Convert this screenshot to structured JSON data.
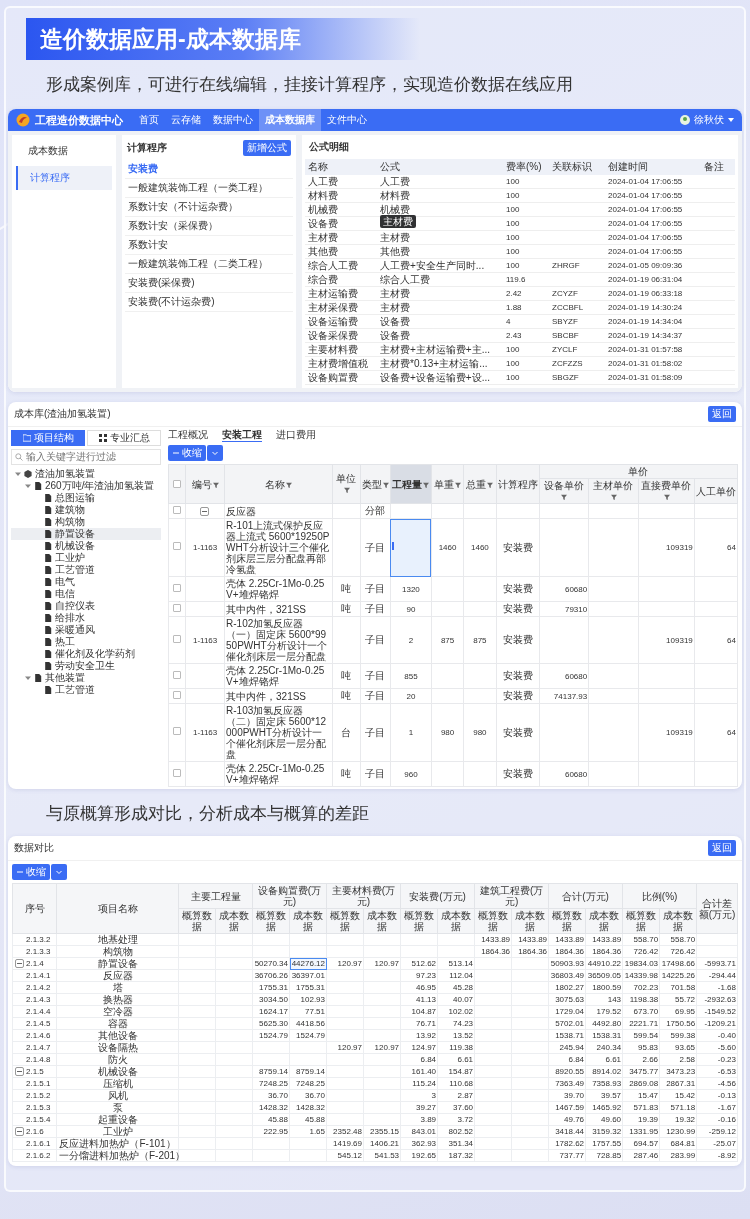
{
  "banner": {
    "title": "造价数据应用-成本数据库"
  },
  "intro": "形成案例库，可进行在线编辑，挂接计算程序，实现造价数据在线应用",
  "portal": {
    "app_name": "工程造价数据中心",
    "nav": [
      {
        "label": "首页",
        "selected": false
      },
      {
        "label": "云存储",
        "selected": false
      },
      {
        "label": "数据中心",
        "selected": false
      },
      {
        "label": "成本数据库",
        "selected": true
      },
      {
        "label": "文件中心",
        "selected": false
      }
    ],
    "user": "徐秋伏",
    "sidebar": [
      {
        "label": "成本数据",
        "selected": false
      },
      {
        "label": "计算程序",
        "selected": true
      }
    ],
    "programs": {
      "title": "计算程序",
      "add_button": "新增公式",
      "items": [
        {
          "label": "安装费",
          "selected": true
        },
        {
          "label": "一般建筑装饰工程（一类工程）",
          "selected": false
        },
        {
          "label": "系数计安（不计运杂费）",
          "selected": false
        },
        {
          "label": "系数计安（采保费）",
          "selected": false
        },
        {
          "label": "系数计安",
          "selected": false
        },
        {
          "label": "一般建筑装饰工程（二类工程）",
          "selected": false
        },
        {
          "label": "安装费(采保费)",
          "selected": false
        },
        {
          "label": "安装费(不计运杂费)",
          "selected": false
        }
      ]
    },
    "formulas": {
      "title": "公式明细",
      "columns": [
        "名称",
        "公式",
        "费率(%)",
        "关联标识",
        "创建时间",
        "备注"
      ],
      "rows": [
        {
          "name": "人工费",
          "formula": "人工费",
          "rate": "100",
          "created": "2024-01-04 17:06:55"
        },
        {
          "name": "材料费",
          "formula": "材料费",
          "rate": "100",
          "created": "2024-01-04 17:06:55"
        },
        {
          "name": "机械费",
          "formula": "机械费",
          "rate": "100",
          "created": "2024-01-04 17:06:55"
        },
        {
          "name": "设备费",
          "tooltip": "主材费",
          "rate": "100",
          "created": "2024-01-04 17:06:55"
        },
        {
          "name": "主材费",
          "formula": "主材费",
          "rate": "100",
          "created": "2024-01-04 17:06:55"
        },
        {
          "name": "其他费",
          "formula": "其他费",
          "rate": "100",
          "created": "2024-01-04 17:06:55"
        },
        {
          "name": "综合人工费",
          "formula": "人工费+安全生产同时...",
          "rate": "100",
          "tag": "ZHRGF",
          "created": "2024-01-05 09:09:36"
        },
        {
          "name": "综合费",
          "formula": "综合人工费",
          "rate": "119.6",
          "created": "2024-01-19 06:31:04"
        },
        {
          "name": "主材运输费",
          "formula": "主材费",
          "rate": "2.42",
          "tag": "ZCYZF",
          "created": "2024-01-19 06:33:18"
        },
        {
          "name": "主材采保费",
          "formula": "主材费",
          "rate": "1.88",
          "tag": "ZCCBFL",
          "created": "2024-01-19 14:30:24"
        },
        {
          "name": "设备运输费",
          "formula": "设备费",
          "rate": "4",
          "tag": "SBYZF",
          "created": "2024-01-19 14:34:04"
        },
        {
          "name": "设备采保费",
          "formula": "设备费",
          "rate": "2.43",
          "tag": "SBCBF",
          "created": "2024-01-19 14:34:37"
        },
        {
          "name": "主要材料费",
          "formula": "主材费+主材运输费+主...",
          "rate": "100",
          "tag": "ZYCLF",
          "created": "2024-01-31 01:57:58"
        },
        {
          "name": "主材费增值税",
          "formula": "主材费*0.13+主材运输...",
          "rate": "100",
          "tag": "ZCFZZS",
          "created": "2024-01-31 01:58:02"
        },
        {
          "name": "设备购置费",
          "formula": "设备费+设备运输费+设...",
          "rate": "100",
          "tag": "SBGZF",
          "created": "2024-01-31 01:58:09"
        }
      ]
    }
  },
  "library": {
    "title": "成本库(渣油加氢装置)",
    "back_button": "返回",
    "side_tabs": [
      {
        "label": "项目结构",
        "selected": true
      },
      {
        "label": "专业汇总",
        "selected": false
      }
    ],
    "search": {
      "placeholder": "输入关键字进行过滤"
    },
    "tree": [
      {
        "label": "渣油加氢装置",
        "expanded": true,
        "selected": false,
        "children": [
          {
            "label": "260万吨/年渣油加氢装置",
            "expanded": true,
            "selected": false,
            "children": [
              {
                "label": "总图运输",
                "selected": false
              },
              {
                "label": "建筑物",
                "selected": false
              },
              {
                "label": "构筑物",
                "selected": false
              },
              {
                "label": "静置设备",
                "selected": true
              },
              {
                "label": "机械设备",
                "selected": false
              },
              {
                "label": "工业炉",
                "selected": false
              },
              {
                "label": "工艺管道",
                "selected": false
              },
              {
                "label": "电气",
                "selected": false
              },
              {
                "label": "电信",
                "selected": false
              },
              {
                "label": "自控仪表",
                "selected": false
              },
              {
                "label": "给排水",
                "selected": false
              },
              {
                "label": "采暖通风",
                "selected": false
              },
              {
                "label": "热工",
                "selected": false
              },
              {
                "label": "催化剂及化学药剂",
                "selected": false
              },
              {
                "label": "劳动安全卫生",
                "selected": false
              }
            ]
          },
          {
            "label": "其他装置",
            "expanded": true,
            "selected": false,
            "children": [
              {
                "label": "工艺管道",
                "selected": false
              }
            ]
          }
        ]
      }
    ],
    "tabs": [
      {
        "label": "工程概况",
        "selected": false
      },
      {
        "label": "安装工程",
        "selected": true
      },
      {
        "label": "进口费用",
        "selected": false
      }
    ],
    "collapse_button": "收缩",
    "all_checked": false,
    "columns": [
      {
        "label": "编号",
        "filter": true,
        "selected": false
      },
      {
        "label": "名称",
        "filter": true,
        "selected": false
      },
      {
        "label": "单位",
        "filter": true,
        "selected": false
      },
      {
        "label": "类型",
        "filter": true,
        "selected": false
      },
      {
        "label": "工程量",
        "filter": true,
        "selected": true
      },
      {
        "label": "单重",
        "filter": true,
        "selected": false
      },
      {
        "label": "总重",
        "filter": true,
        "selected": false
      },
      {
        "label": "计算程序",
        "filter": false,
        "selected": false
      }
    ],
    "price_group": {
      "label": "单价",
      "columns": [
        {
          "label": "设备单价",
          "filter": true
        },
        {
          "label": "主材单价",
          "filter": true
        },
        {
          "label": "直接费单价",
          "filter": true
        },
        {
          "label": "人工单价",
          "filter": false
        }
      ]
    },
    "rows": [
      {
        "kind": "group",
        "expanded": true,
        "checked": false,
        "editing": false,
        "name": "反应器",
        "type": "分部"
      },
      {
        "kind": "item",
        "checked": false,
        "editing": true,
        "code": "1-1163",
        "name": "R-101上流式保护反应器上流式 5600*19250PWHT分析设计三个催化剂床层三层分配盘再部冷氢盘",
        "type": "子目",
        "unit_weight": "1460",
        "total_weight": "1460",
        "program": "安装费",
        "direct_price": "109319",
        "labor_price": "64"
      },
      {
        "kind": "item",
        "checked": false,
        "editing": false,
        "name": "壳体 2.25Cr-1Mo-0.25V+堆焊铬焊",
        "unit": "吨",
        "type": "子目",
        "qty": "1320",
        "program": "安装费",
        "equip_price": "60680"
      },
      {
        "kind": "item",
        "checked": false,
        "editing": false,
        "name": "其中内件，321SS",
        "unit": "吨",
        "type": "子目",
        "qty": "90",
        "program": "安装费",
        "equip_price": "79310"
      },
      {
        "kind": "item",
        "checked": false,
        "editing": false,
        "code": "1-1163",
        "name": "R-102加氢反应器（一）固定床 5600*9950PWHT分析设计一个催化剂床层一层分配盘",
        "type": "子目",
        "qty": "2",
        "unit_weight": "875",
        "total_weight": "875",
        "program": "安装费",
        "direct_price": "109319",
        "labor_price": "64"
      },
      {
        "kind": "item",
        "checked": false,
        "editing": false,
        "name": "壳体 2.25Cr-1Mo-0.25V+堆焊铬焊",
        "unit": "吨",
        "type": "子目",
        "qty": "855",
        "program": "安装费",
        "equip_price": "60680"
      },
      {
        "kind": "item",
        "checked": false,
        "editing": false,
        "name": "其中内件，321SS",
        "unit": "吨",
        "type": "子目",
        "qty": "20",
        "program": "安装费",
        "equip_price": "74137.93"
      },
      {
        "kind": "item",
        "checked": false,
        "editing": false,
        "code": "1-1163",
        "name": "R-103加氢反应器（二）固定床 5600*12000PWHT分析设计一个催化剂床层一层分配盘",
        "unit": "台",
        "type": "子目",
        "qty": "1",
        "unit_weight": "980",
        "total_weight": "980",
        "program": "安装费",
        "direct_price": "109319",
        "labor_price": "64"
      },
      {
        "kind": "item",
        "checked": false,
        "editing": false,
        "name": "壳体 2.25Cr-1Mo-0.25V+堆焊铬焊",
        "unit": "吨",
        "type": "子目",
        "qty": "960",
        "program": "安装费",
        "equip_price": "60680"
      }
    ]
  },
  "compare_intro": "与原概算形成对比，分析成本与概算的差距",
  "comparison": {
    "title": "数据对比",
    "back_button": "返回",
    "collapse_button": "收缩",
    "columns": [
      {
        "label": "序号"
      },
      {
        "label": "项目名称"
      },
      {
        "label": "主要工程量",
        "sub": [
          "概算数据",
          "成本数据"
        ]
      },
      {
        "label": "设备购置费(万元)",
        "sub": [
          "概算数据",
          "成本数据"
        ]
      },
      {
        "label": "主要材料费(万元)",
        "sub": [
          "概算数据",
          "成本数据"
        ]
      },
      {
        "label": "安装费(万元)",
        "sub": [
          "概算数据",
          "成本数据"
        ]
      },
      {
        "label": "建筑工程费(万元)",
        "sub": [
          "概算数据",
          "成本数据"
        ]
      },
      {
        "label": "合计(万元)",
        "sub": [
          "概算数据",
          "成本数据"
        ]
      },
      {
        "label": "比例(%)",
        "sub": [
          "概算数据",
          "成本数据"
        ]
      },
      {
        "label": "合计差额(万元)"
      }
    ],
    "rows": [
      {
        "kind": "item",
        "selected": false,
        "seq": "2.1.3.2",
        "name": "地基处理",
        "build_est": "1433.89",
        "build_cost": "1433.89",
        "total_est": "1433.89",
        "total_cost": "1433.89",
        "ratio_est": "558.70",
        "ratio_cost": "558.70"
      },
      {
        "kind": "item",
        "selected": false,
        "seq": "2.1.3.3",
        "name": "构筑物",
        "build_est": "1864.36",
        "build_cost": "1864.36",
        "total_est": "1864.36",
        "total_cost": "1864.36",
        "ratio_est": "726.42",
        "ratio_cost": "726.42"
      },
      {
        "kind": "group",
        "expanded": true,
        "selected": true,
        "seq": "2.1.4",
        "name": "静置设备",
        "equip_est": "50270.34",
        "equip_cost": "44276.12",
        "mat_est": "120.97",
        "mat_cost": "120.97",
        "inst_est": "512.62",
        "inst_cost": "513.14",
        "total_est": "50903.93",
        "total_cost": "44910.22",
        "ratio_est": "19834.03",
        "ratio_cost": "17498.66",
        "diff": "-5993.71"
      },
      {
        "kind": "item",
        "selected": false,
        "seq": "2.1.4.1",
        "name": "反应器",
        "equip_est": "36706.26",
        "equip_cost": "36397.01",
        "inst_est": "97.23",
        "inst_cost": "112.04",
        "total_est": "36803.49",
        "total_cost": "36509.05",
        "ratio_est": "14339.98",
        "ratio_cost": "14225.26",
        "diff": "-294.44"
      },
      {
        "kind": "item",
        "selected": false,
        "seq": "2.1.4.2",
        "name": "塔",
        "equip_est": "1755.31",
        "equip_cost": "1755.31",
        "inst_est": "46.95",
        "inst_cost": "45.28",
        "total_est": "1802.27",
        "total_cost": "1800.59",
        "ratio_est": "702.23",
        "ratio_cost": "701.58",
        "diff": "-1.68"
      },
      {
        "kind": "item",
        "selected": false,
        "seq": "2.1.4.3",
        "name": "换热器",
        "equip_est": "3034.50",
        "equip_cost": "102.93",
        "inst_est": "41.13",
        "inst_cost": "40.07",
        "total_est": "3075.63",
        "total_cost": "143",
        "ratio_est": "1198.38",
        "ratio_cost": "55.72",
        "diff": "-2932.63"
      },
      {
        "kind": "item",
        "selected": false,
        "seq": "2.1.4.4",
        "name": "空冷器",
        "equip_est": "1624.17",
        "equip_cost": "77.51",
        "inst_est": "104.87",
        "inst_cost": "102.02",
        "total_est": "1729.04",
        "total_cost": "179.52",
        "ratio_est": "673.70",
        "ratio_cost": "69.95",
        "diff": "-1549.52"
      },
      {
        "kind": "item",
        "selected": false,
        "seq": "2.1.4.5",
        "name": "容器",
        "equip_est": "5625.30",
        "equip_cost": "4418.56",
        "inst_est": "76.71",
        "inst_cost": "74.23",
        "total_est": "5702.01",
        "total_cost": "4492.80",
        "ratio_est": "2221.71",
        "ratio_cost": "1750.56",
        "diff": "-1209.21"
      },
      {
        "kind": "item",
        "selected": false,
        "seq": "2.1.4.6",
        "name": "其他设备",
        "equip_est": "1524.79",
        "equip_cost": "1524.79",
        "inst_est": "13.92",
        "inst_cost": "13.52",
        "total_est": "1538.71",
        "total_cost": "1538.31",
        "ratio_est": "599.54",
        "ratio_cost": "599.38",
        "diff": "-0.40"
      },
      {
        "kind": "item",
        "selected": false,
        "seq": "2.1.4.7",
        "name": "设备隔热",
        "mat_est": "120.97",
        "mat_cost": "120.97",
        "inst_est": "124.97",
        "inst_cost": "119.38",
        "total_est": "245.94",
        "total_cost": "240.34",
        "ratio_est": "95.83",
        "ratio_cost": "93.65",
        "diff": "-5.60"
      },
      {
        "kind": "item",
        "selected": false,
        "seq": "2.1.4.8",
        "name": "防火",
        "inst_est": "6.84",
        "inst_cost": "6.61",
        "total_est": "6.84",
        "total_cost": "6.61",
        "ratio_est": "2.66",
        "ratio_cost": "2.58",
        "diff": "-0.23"
      },
      {
        "kind": "group",
        "expanded": true,
        "selected": false,
        "seq": "2.1.5",
        "name": "机械设备",
        "equip_est": "8759.14",
        "equip_cost": "8759.14",
        "inst_est": "161.40",
        "inst_cost": "154.87",
        "total_est": "8920.55",
        "total_cost": "8914.02",
        "ratio_est": "3475.77",
        "ratio_cost": "3473.23",
        "diff": "-6.53"
      },
      {
        "kind": "item",
        "selected": false,
        "seq": "2.1.5.1",
        "name": "压缩机",
        "equip_est": "7248.25",
        "equip_cost": "7248.25",
        "inst_est": "115.24",
        "inst_cost": "110.68",
        "total_est": "7363.49",
        "total_cost": "7358.93",
        "ratio_est": "2869.08",
        "ratio_cost": "2867.31",
        "diff": "-4.56"
      },
      {
        "kind": "item",
        "selected": false,
        "seq": "2.1.5.2",
        "name": "风机",
        "equip_est": "36.70",
        "equip_cost": "36.70",
        "inst_est": "3",
        "inst_cost": "2.87",
        "total_est": "39.70",
        "total_cost": "39.57",
        "ratio_est": "15.47",
        "ratio_cost": "15.42",
        "diff": "-0.13"
      },
      {
        "kind": "item",
        "selected": false,
        "seq": "2.1.5.3",
        "name": "泵",
        "equip_est": "1428.32",
        "equip_cost": "1428.32",
        "inst_est": "39.27",
        "inst_cost": "37.60",
        "total_est": "1467.59",
        "total_cost": "1465.92",
        "ratio_est": "571.83",
        "ratio_cost": "571.18",
        "diff": "-1.67"
      },
      {
        "kind": "item",
        "selected": false,
        "seq": "2.1.5.4",
        "name": "起重设备",
        "equip_est": "45.88",
        "equip_cost": "45.88",
        "inst_est": "3.89",
        "inst_cost": "3.72",
        "total_est": "49.76",
        "total_cost": "49.60",
        "ratio_est": "19.39",
        "ratio_cost": "19.32",
        "diff": "-0.16"
      },
      {
        "kind": "group",
        "expanded": true,
        "selected": false,
        "seq": "2.1.6",
        "name": "工业炉",
        "equip_est": "222.95",
        "equip_cost": "1.65",
        "mat_est": "2352.48",
        "mat_cost": "2355.15",
        "inst_est": "843.01",
        "inst_cost": "802.52",
        "total_est": "3418.44",
        "total_cost": "3159.32",
        "ratio_est": "1331.95",
        "ratio_cost": "1230.99",
        "diff": "-259.12"
      },
      {
        "kind": "item",
        "selected": false,
        "seq": "2.1.6.1",
        "name": "反应进料加热炉（F-101）",
        "mat_est": "1419.69",
        "mat_cost": "1406.21",
        "inst_est": "362.93",
        "inst_cost": "351.34",
        "total_est": "1782.62",
        "total_cost": "1757.55",
        "ratio_est": "694.57",
        "ratio_cost": "684.81",
        "diff": "-25.07"
      },
      {
        "kind": "item",
        "selected": false,
        "seq": "2.1.6.2",
        "name": "一分馏进料加热炉（F-201）",
        "mat_est": "545.12",
        "mat_cost": "541.53",
        "inst_est": "192.65",
        "inst_cost": "187.32",
        "total_est": "737.77",
        "total_cost": "728.85",
        "ratio_est": "287.46",
        "ratio_cost": "283.99",
        "diff": "-8.92"
      }
    ]
  }
}
